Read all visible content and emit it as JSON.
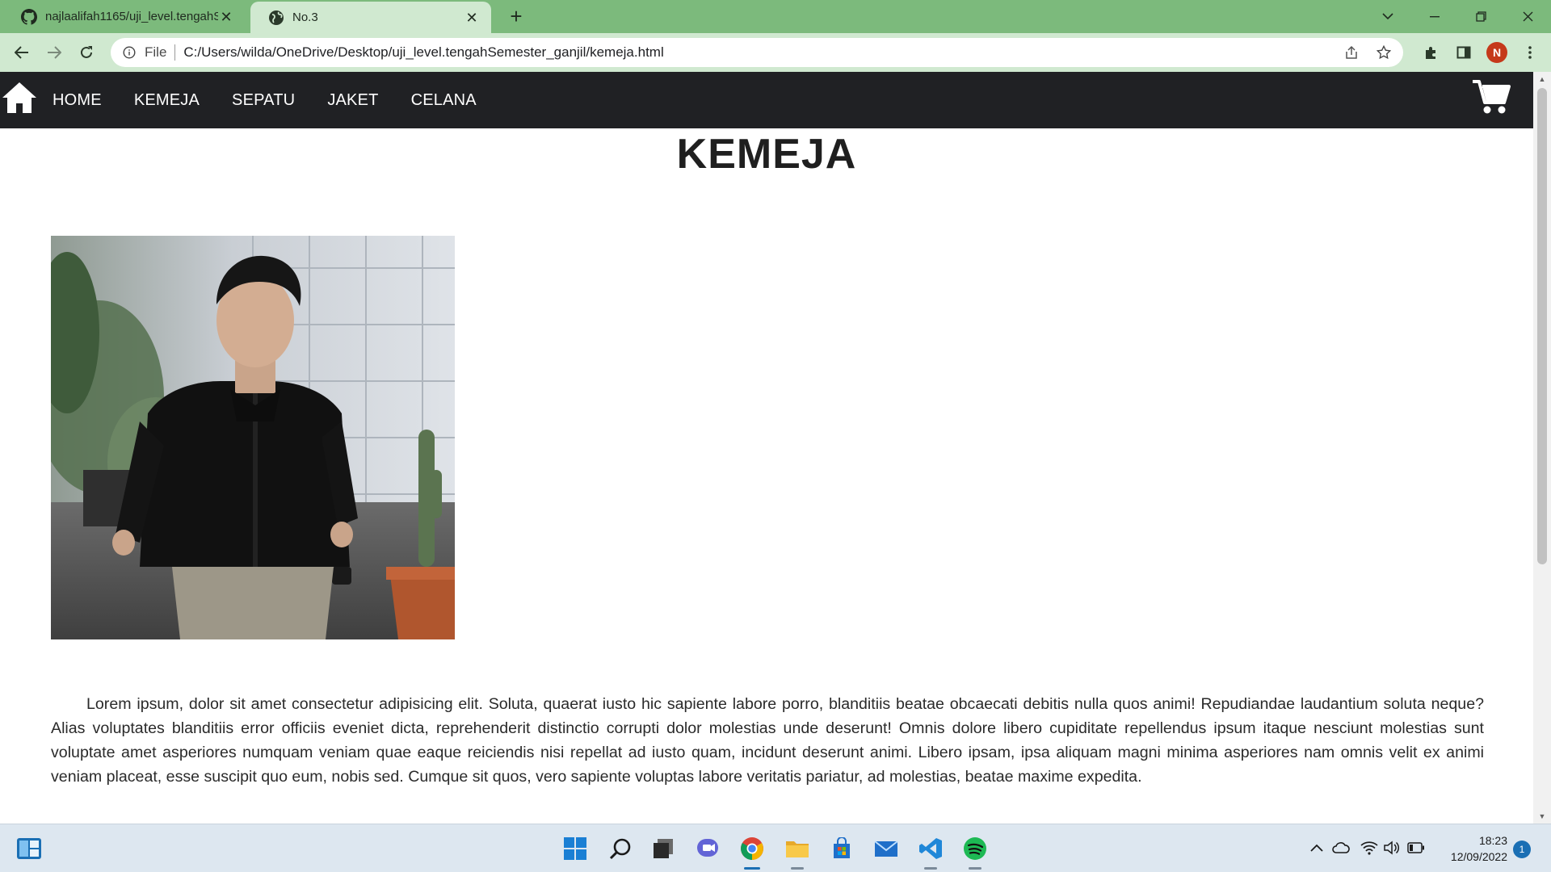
{
  "browser": {
    "tabs": [
      {
        "title": "najlaalifah1165/uji_level.tengahS",
        "icon": "github-icon",
        "active": false
      },
      {
        "title": "No.3",
        "icon": "globe-icon",
        "active": true
      }
    ],
    "file_label": "File",
    "url": "C:/Users/wilda/OneDrive/Desktop/uji_level.tengahSemester_ganjil/kemeja.html",
    "profile_initial": "N"
  },
  "site": {
    "nav": {
      "home_icon": "home-icon",
      "links": [
        "HOME",
        "KEMEJA",
        "SEPATU",
        "JAKET",
        "CELANA"
      ],
      "cart_icon": "cart-icon",
      "background": "#202124"
    },
    "page_title": "KEMEJA",
    "image": "man-in-black-shirt-photo",
    "description": "Lorem ipsum, dolor sit amet consectetur adipisicing elit. Soluta, quaerat iusto hic sapiente labore porro, blanditiis beatae obcaecati debitis nulla quos animi! Repudiandae laudantium soluta neque? Alias voluptates blanditiis error officiis eveniet dicta, reprehenderit distinctio corrupti dolor molestias unde deserunt! Omnis dolore libero cupiditate repellendus ipsum itaque nesciunt molestias sunt voluptate amet asperiores numquam veniam quae eaque reiciendis nisi repellat ad iusto quam, incidunt deserunt animi. Libero ipsam, ipsa aliquam magni minima asperiores nam omnis velit ex animi veniam placeat, esse suscipit quo eum, nobis sed. Cumque sit quos, vero sapiente voluptas labore veritatis pariatur, ad molestias, beatae maxime expedita."
  },
  "taskbar": {
    "time": "18:23",
    "date": "12/09/2022",
    "notifications": "1"
  },
  "colors": {
    "tabbar": "#7cba7c",
    "toolbar": "#d0e9d0",
    "nav": "#202124",
    "taskbar": "#dde7f0"
  }
}
